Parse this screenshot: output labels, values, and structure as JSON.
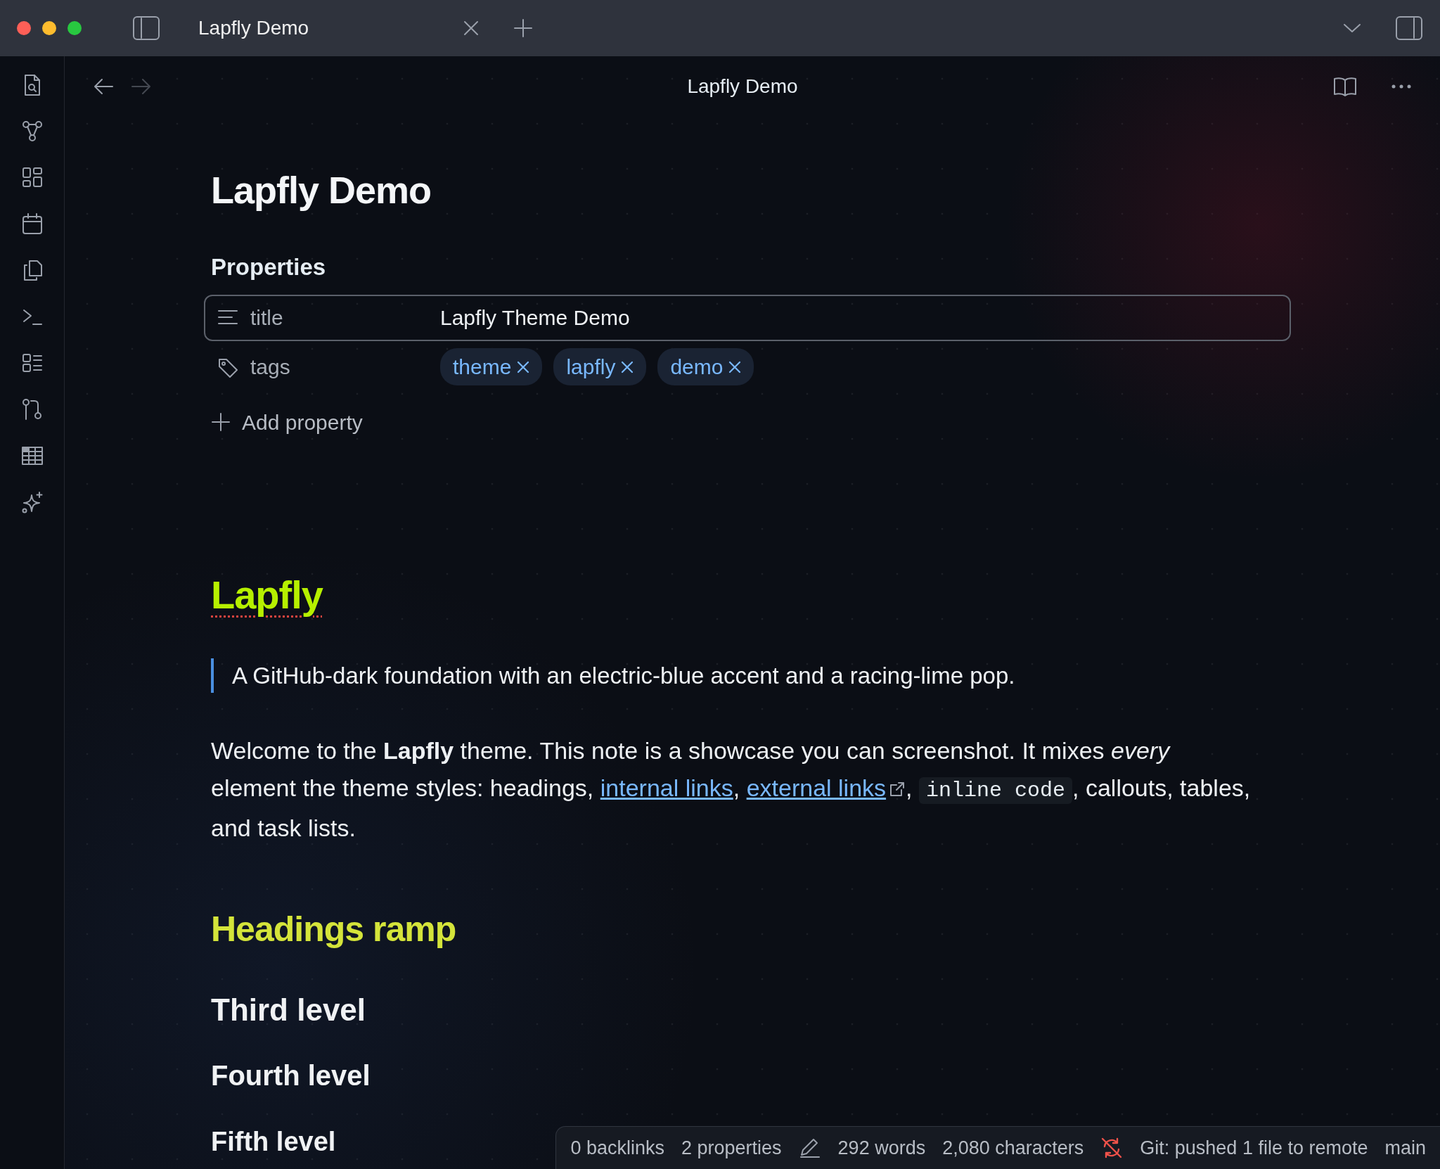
{
  "window": {
    "tab_title": "Lapfly Demo"
  },
  "header": {
    "title": "Lapfly Demo",
    "back_disabled": false,
    "forward_disabled": true
  },
  "note": {
    "title": "Lapfly Demo",
    "properties": {
      "heading": "Properties",
      "items": [
        {
          "kind": "text",
          "name": "title",
          "value": "Lapfly Theme Demo",
          "selected": true
        },
        {
          "kind": "tags",
          "name": "tags",
          "tags": [
            "theme",
            "lapfly",
            "demo"
          ],
          "selected": false
        }
      ],
      "add_label": "Add property"
    },
    "heading": {
      "text": "Lapfly",
      "spellcheck_error": true
    },
    "quote": "A GitHub-dark foundation with an electric-blue accent and a racing-lime pop.",
    "paragraph": [
      {
        "kind": "text",
        "text": "Welcome to the **Lapfly** theme. This note is a showcase you can screenshot. It mixes *every* element the theme styles: headings, "
      },
      {
        "kind": "link",
        "text": "internal links"
      },
      {
        "kind": "text",
        "text": ", "
      },
      {
        "kind": "external_link",
        "text": "external links"
      },
      {
        "kind": "text",
        "text": ", "
      },
      {
        "kind": "code",
        "text": "inline code"
      },
      {
        "kind": "text",
        "text": ", callouts, tables, and task lists."
      }
    ],
    "sections": [
      {
        "kind": "h2",
        "text": "Headings ramp"
      },
      {
        "kind": "h3",
        "text": "Third level"
      },
      {
        "kind": "h4",
        "text": "Fourth level"
      },
      {
        "kind": "h5",
        "text": "Fifth level"
      }
    ]
  },
  "status_bar": [
    {
      "text": "0 backlinks"
    },
    {
      "text": "2 properties"
    },
    {
      "kind": "pencil",
      "text": "292 words"
    },
    {
      "text": "2,080 characters"
    },
    {
      "kind": "sync",
      "text": "Git: pushed 1 file to remote"
    },
    {
      "text": "main"
    }
  ]
}
